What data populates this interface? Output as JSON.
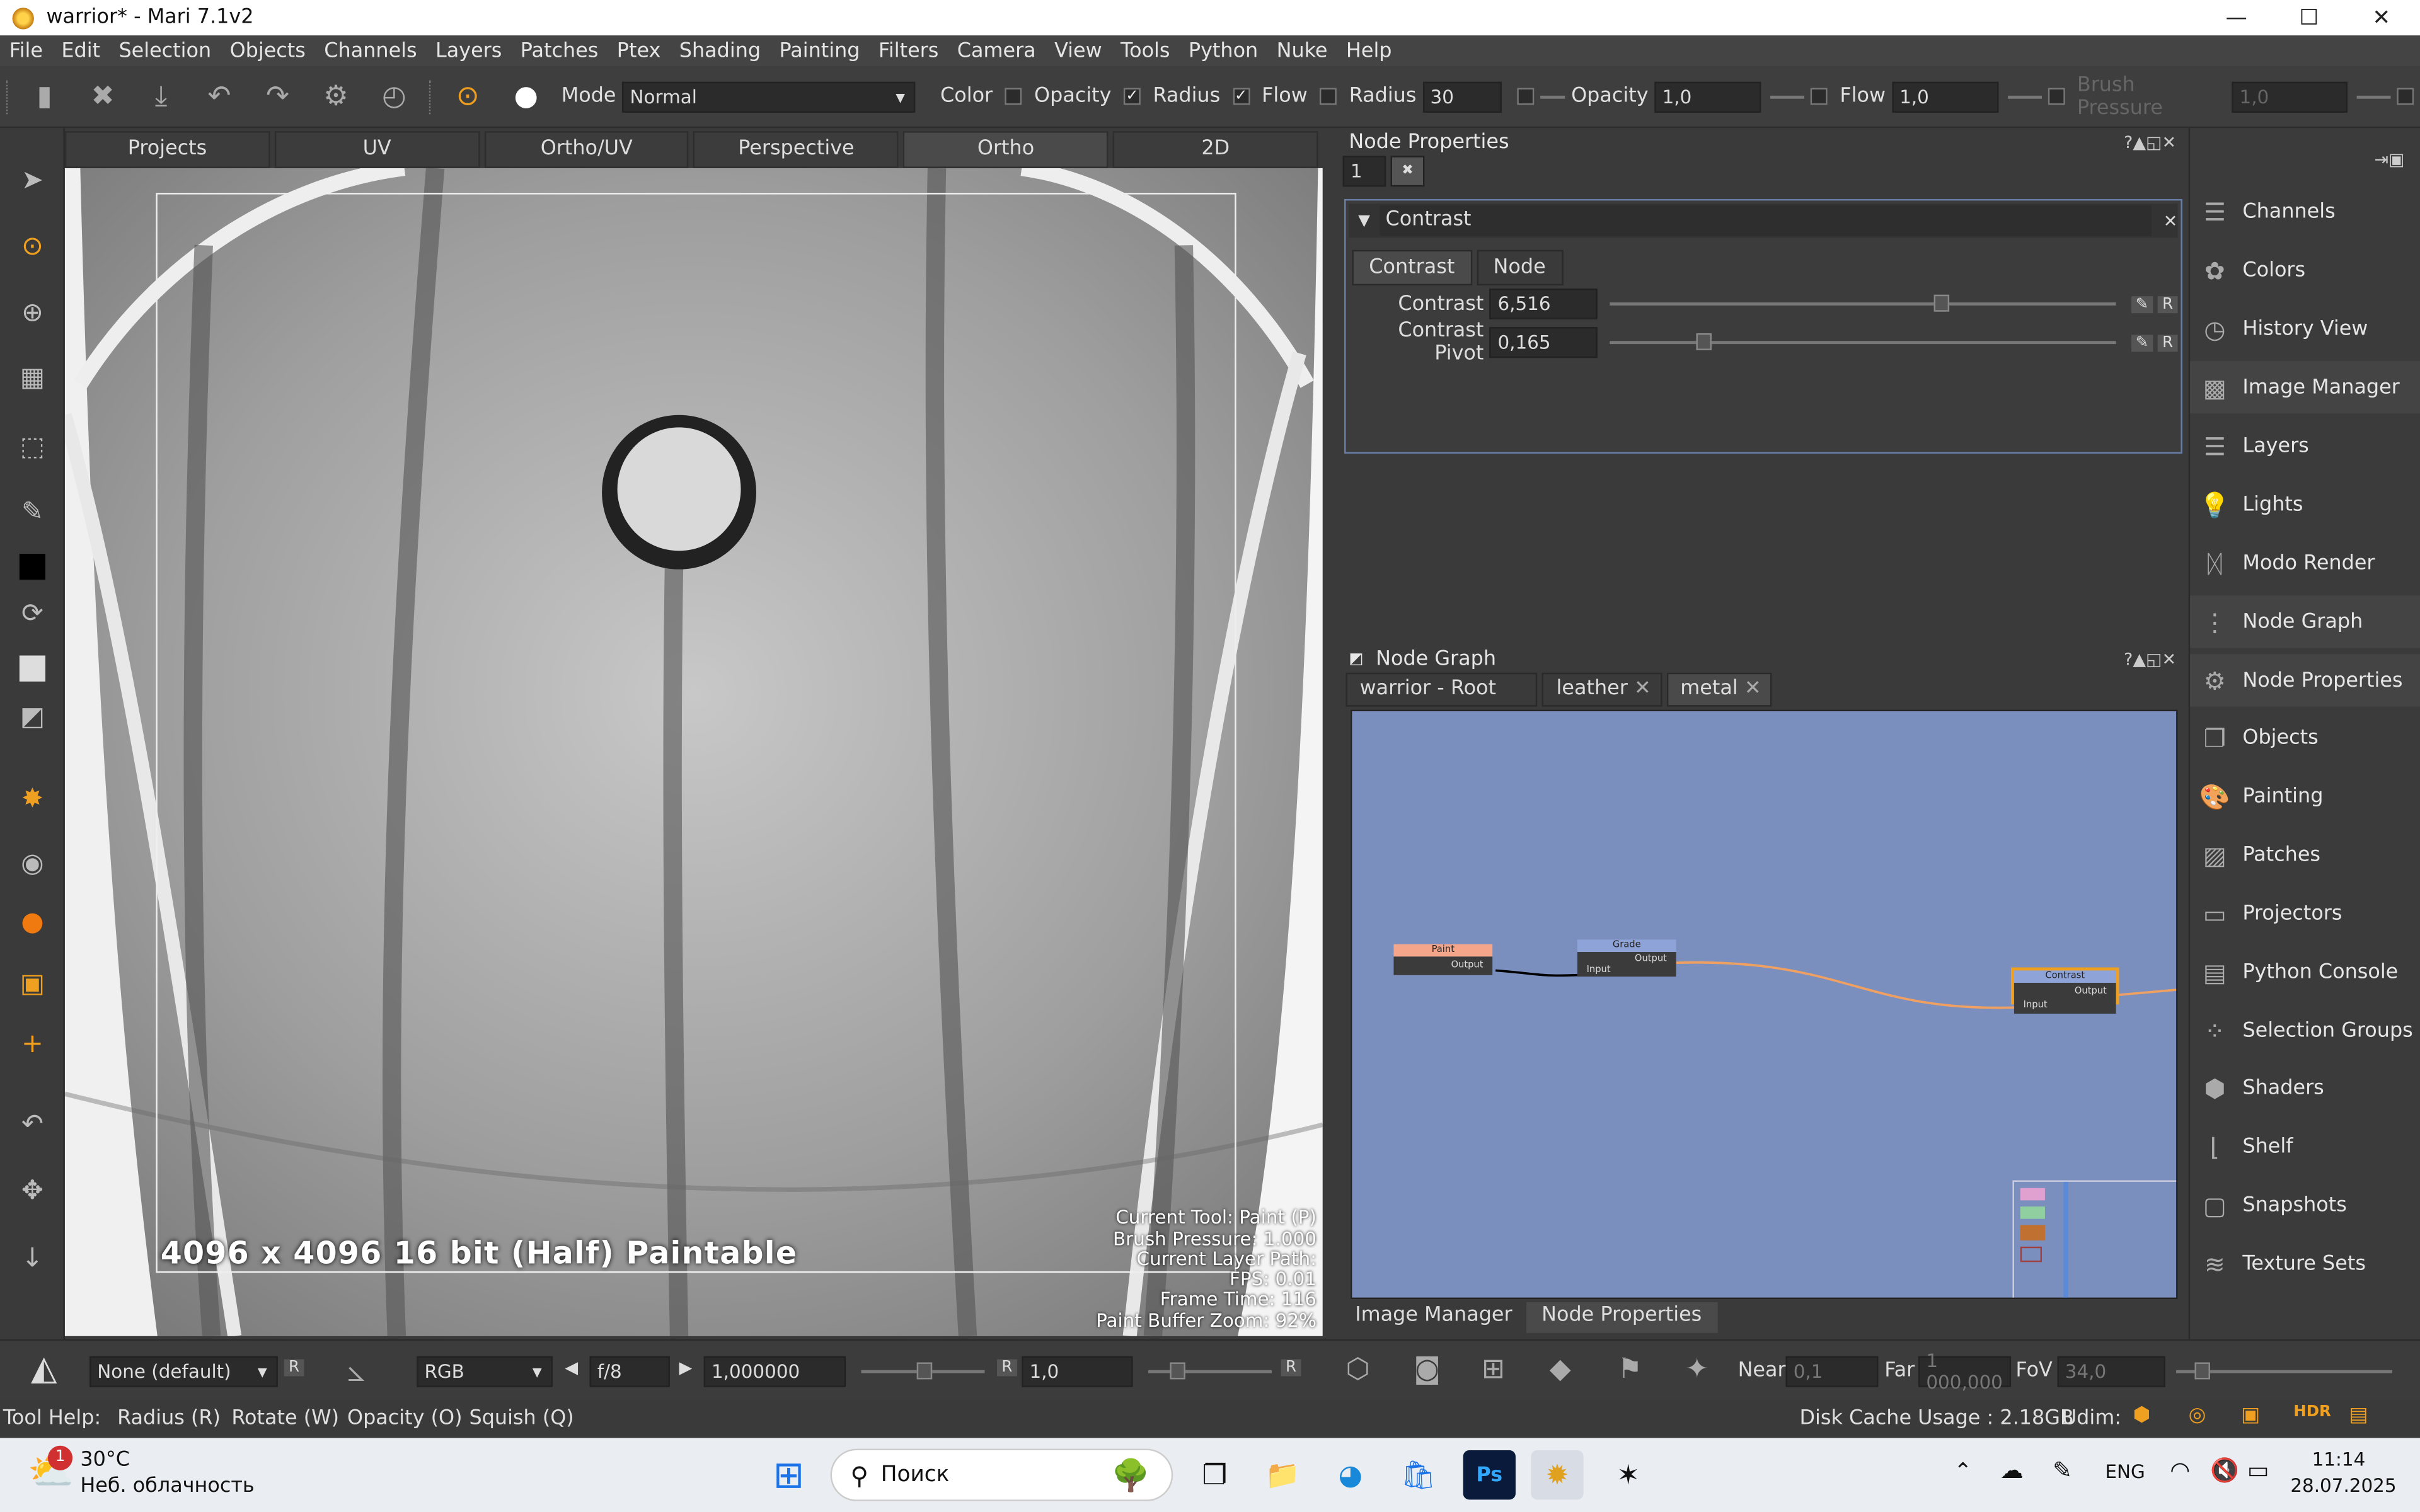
{
  "window": {
    "title": "warrior* - Mari 7.1v2",
    "minimize": "—",
    "maximize": "☐",
    "close": "✕"
  },
  "menu": [
    "File",
    "Edit",
    "Selection",
    "Objects",
    "Channels",
    "Layers",
    "Patches",
    "Ptex",
    "Shading",
    "Painting",
    "Filters",
    "Camera",
    "View",
    "Tools",
    "Python",
    "Nuke",
    "Help"
  ],
  "toolbar": {
    "mode_label": "Mode",
    "mode_value": "Normal",
    "color_label": "Color",
    "opacity_label": "Opacity",
    "radius_label": "Radius",
    "flow_label": "Flow",
    "radius2_label": "Radius",
    "radius_value": "30",
    "opacity2_label": "Opacity",
    "opacity_value": "1,0",
    "flow2_label": "Flow",
    "flow_value": "1,0",
    "brush_pressure_label": "Brush Pressure",
    "brush_pressure_value": "1,0"
  },
  "view_tabs": [
    "Projects",
    "UV",
    "Ortho/UV",
    "Perspective",
    "Ortho",
    "2D"
  ],
  "active_view_tab": "Ortho",
  "viewport": {
    "resolution_text": "4096 x 4096 16 bit (Half) Paintable",
    "hud": [
      "Current Tool: Paint (P)",
      "Brush Pressure: 1.000",
      "Current Layer Path:",
      "FPS: 0.01",
      "Frame Time: 116",
      "Paint Buffer Zoom: 92%"
    ]
  },
  "node_properties": {
    "title": "Node Properties",
    "field_value": "1",
    "section_title": "Contrast",
    "tabs": [
      "Contrast",
      "Node"
    ],
    "params": [
      {
        "label": "Contrast",
        "value": "6,516",
        "slider": 0.64
      },
      {
        "label": "Contrast Pivot",
        "value": "0,165",
        "slider": 0.17
      }
    ]
  },
  "node_graph": {
    "title": "Node Graph",
    "tabs": [
      "warrior - Root",
      "leather",
      "metal"
    ],
    "active_tab": "metal",
    "nodes": [
      {
        "name": "Paint",
        "output": "Output",
        "color": "#f4a58a"
      },
      {
        "name": "Grade",
        "output": "Output",
        "input": "Input",
        "color": "#8ea3d8"
      },
      {
        "name": "Contrast",
        "output": "Output",
        "input": "Input",
        "color": "#8ea3d8"
      }
    ],
    "bottom_tabs": [
      "Image Manager",
      "Node Properties"
    ]
  },
  "right_panel": [
    {
      "label": "Channels",
      "icon": "channels-icon"
    },
    {
      "label": "Colors",
      "icon": "colors-icon"
    },
    {
      "label": "History View",
      "icon": "history-icon"
    },
    {
      "label": "Image Manager",
      "icon": "image-manager-icon"
    },
    {
      "label": "Layers",
      "icon": "layers-icon"
    },
    {
      "label": "Lights",
      "icon": "lights-icon"
    },
    {
      "label": "Modo Render",
      "icon": "modo-render-icon"
    },
    {
      "label": "Node Graph",
      "icon": "node-graph-icon"
    },
    {
      "label": "Node Properties",
      "icon": "node-properties-icon"
    },
    {
      "label": "Objects",
      "icon": "objects-icon"
    },
    {
      "label": "Painting",
      "icon": "painting-icon"
    },
    {
      "label": "Patches",
      "icon": "patches-icon"
    },
    {
      "label": "Projectors",
      "icon": "projectors-icon"
    },
    {
      "label": "Python Console",
      "icon": "python-console-icon"
    },
    {
      "label": "Selection Groups",
      "icon": "selection-groups-icon"
    },
    {
      "label": "Shaders",
      "icon": "shaders-icon"
    },
    {
      "label": "Shelf",
      "icon": "shelf-icon"
    },
    {
      "label": "Snapshots",
      "icon": "snapshots-icon"
    },
    {
      "label": "Texture Sets",
      "icon": "texture-sets-icon"
    }
  ],
  "bottom_bar": {
    "lut": "None (default)",
    "r1": "R",
    "channel": "RGB",
    "fstop": "f/8",
    "gain": "1,000000",
    "r2": "R",
    "gamma": "1,0",
    "r3": "R",
    "near_label": "Near",
    "near_value": "0,1",
    "far_label": "Far",
    "far_value": "1 000,000",
    "fov_label": "FoV",
    "fov_value": "34,0"
  },
  "status": {
    "tool_help": "Tool Help:",
    "radius": "Radius (R)",
    "rotate": "Rotate (W)",
    "opacity": "Opacity (O)",
    "squish": "Squish (Q)",
    "disk_cache": "Disk Cache Usage : 2.18GB",
    "udim": "Udim:"
  },
  "taskbar": {
    "weather_temp": "30°C",
    "weather_desc": "Неб. облачность",
    "weather_badge": "1",
    "search": "Поиск",
    "lang": "ENG",
    "time": "11:14",
    "date": "28.07.2025"
  }
}
